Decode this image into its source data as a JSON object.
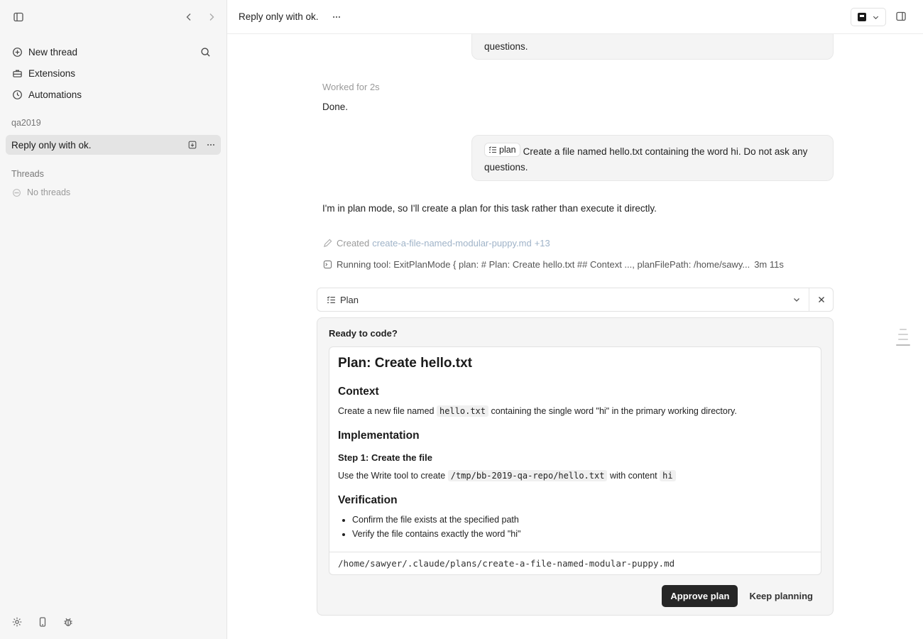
{
  "sidebar": {
    "nav": {
      "new_thread": "New thread",
      "extensions": "Extensions",
      "automations": "Automations"
    },
    "project": "qa2019",
    "active_thread": "Reply only with ok.",
    "threads_label": "Threads",
    "no_threads": "No threads"
  },
  "header": {
    "title": "Reply only with ok."
  },
  "conversation": {
    "bubble1_text": "questions.",
    "worked_for": "Worked for 2s",
    "done": "Done.",
    "bubble2_chip": "plan",
    "bubble2_text": "Create a file named hello.txt containing the word hi. Do not ask any questions.",
    "assistant_text": "I'm in plan mode, so I'll create a plan for this task rather than execute it directly.",
    "created_label": "Created",
    "created_file": "create-a-file-named-modular-puppy.md",
    "created_count": "+13",
    "running_tool": "Running tool: ExitPlanMode { plan: # Plan: Create hello.txt ## Context ..., planFilePath: /home/sawy...",
    "running_time": "3m 11s"
  },
  "plan_bar": {
    "label": "Plan"
  },
  "plan_panel": {
    "ready": "Ready to code?",
    "title": "Plan: Create hello.txt",
    "context_heading": "Context",
    "context_pre": "Create a new file named",
    "context_code": "hello.txt",
    "context_post": "containing the single word \"hi\" in the primary working directory.",
    "impl_heading": "Implementation",
    "step1_heading": "Step 1: Create the file",
    "step1_pre": "Use the Write tool to create",
    "step1_code": "/tmp/bb-2019-qa-repo/hello.txt",
    "step1_mid": "with content",
    "step1_code2": "hi",
    "verify_heading": "Verification",
    "verify_items": [
      "Confirm the file exists at the specified path",
      "Verify the file contains exactly the word \"hi\""
    ],
    "path": "/home/sawyer/.claude/plans/create-a-file-named-modular-puppy.md",
    "approve": "Approve plan",
    "keep": "Keep planning"
  }
}
